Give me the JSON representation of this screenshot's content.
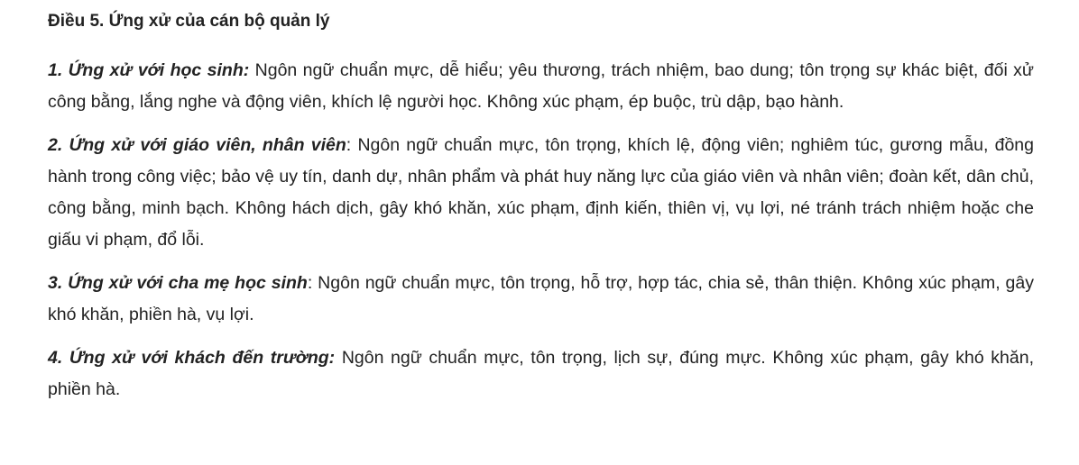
{
  "article": {
    "heading": "Điều 5. Ứng xử của cán bộ quản lý",
    "paragraphs": [
      {
        "lead": "1. Ứng xử với học sinh:",
        "text": " Ngôn ngữ chuẩn mực, dễ hiểu; yêu thương, trách nhiệm, bao dung; tôn trọng sự khác biệt, đối xử công bằng, lắng nghe và động viên, khích lệ người học. Không xúc phạm, ép buộc, trù dập, bạo hành."
      },
      {
        "lead": "2. Ứng xử với giáo viên, nhân viên",
        "text": ": Ngôn ngữ chuẩn mực, tôn trọng, khích lệ, động viên; nghiêm túc, gương mẫu, đồng hành trong công việc; bảo vệ uy tín, danh dự, nhân phẩm và phát huy năng lực của giáo viên và nhân viên; đoàn kết, dân chủ, công bằng, minh bạch. Không hách dịch, gây khó khăn, xúc phạm, định kiến, thiên vị, vụ lợi, né tránh trách nhiệm hoặc che giấu vi phạm, đổ lỗi."
      },
      {
        "lead": "3. Ứng xử với cha mẹ học sinh",
        "text": ": Ngôn ngữ chuẩn mực, tôn trọng, hỗ trợ, hợp tác, chia sẻ, thân thiện. Không xúc phạm, gây khó khăn, phiền hà, vụ lợi."
      },
      {
        "lead": "4. Ứng xử với khách đến trường:",
        "text": " Ngôn ngữ chuẩn mực, tôn trọng, lịch sự, đúng mực. Không xúc phạm, gây khó khăn, phiền hà."
      }
    ]
  }
}
